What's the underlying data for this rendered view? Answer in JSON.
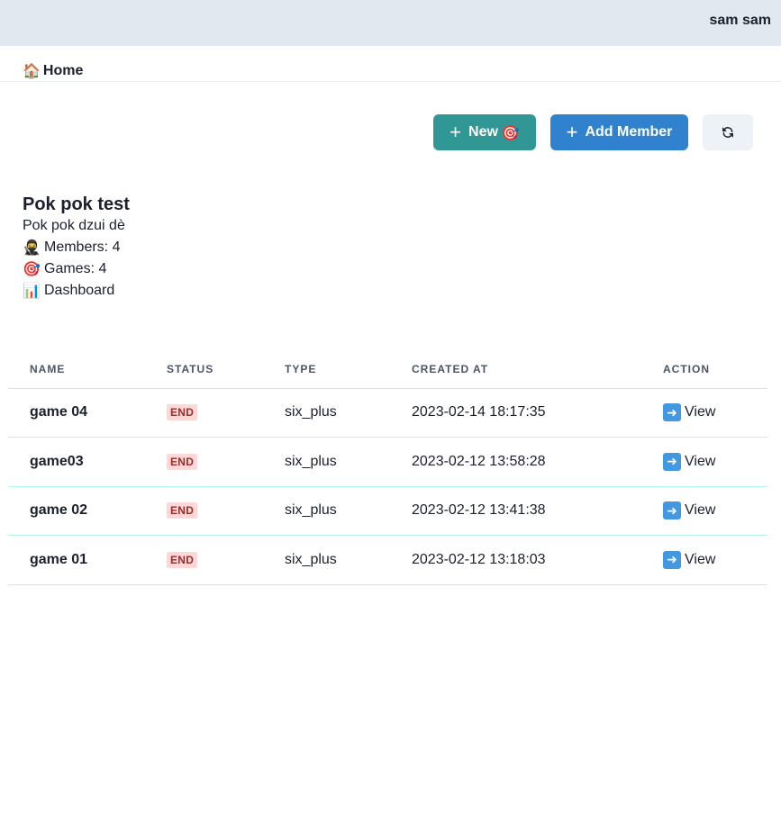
{
  "header": {
    "user_name": "sam sam"
  },
  "breadcrumb": {
    "home_icon": "🏠",
    "home_label": "Home"
  },
  "toolbar": {
    "new_label": "New",
    "new_emoji": "🎯",
    "add_member_label": "Add Member",
    "refresh_icon": "refresh-icon"
  },
  "group": {
    "name": "Pok pok test",
    "description": "Pok pok dzui dè",
    "members_icon": "🥷",
    "members_text": "Members: 4",
    "games_icon": "🎯",
    "games_text": "Games: 4",
    "dashboard_icon": "📊",
    "dashboard_text": "Dashboard"
  },
  "table": {
    "headers": [
      "NAME",
      "STATUS",
      "TYPE",
      "CREATED AT",
      "ACTION"
    ],
    "rows": [
      {
        "name": "game 04",
        "status": "END",
        "type": "six_plus",
        "created_at": "2023-02-14 18:17:35",
        "action": "View"
      },
      {
        "name": "game03",
        "status": "END",
        "type": "six_plus",
        "created_at": "2023-02-12 13:58:28",
        "action": "View"
      },
      {
        "name": "game 02",
        "status": "END",
        "type": "six_plus",
        "created_at": "2023-02-12 13:41:38",
        "action": "View"
      },
      {
        "name": "game 01",
        "status": "END",
        "type": "six_plus",
        "created_at": "2023-02-12 13:18:03",
        "action": "View"
      }
    ]
  },
  "colors": {
    "topbar": "#e2e8f0",
    "teal_button": "#319795",
    "blue_button": "#3182ce",
    "badge_bg": "#fed7d7",
    "badge_text": "#9b2c2c"
  }
}
